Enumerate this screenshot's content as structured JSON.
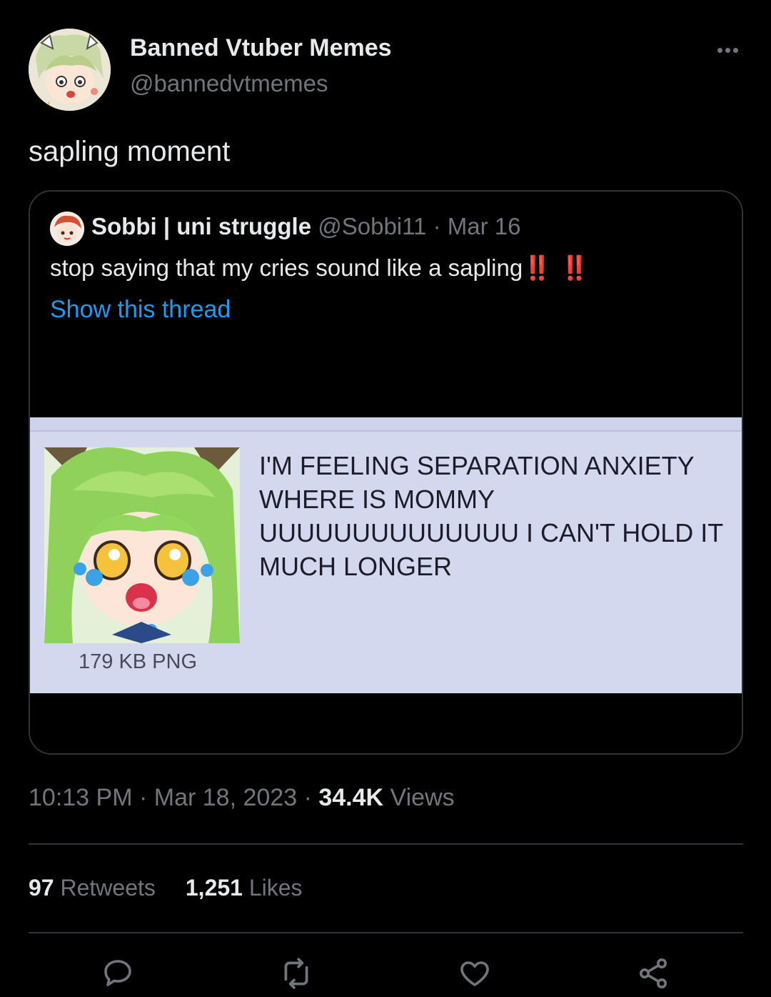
{
  "author": {
    "name": "Banned Vtuber Memes",
    "handle": "@bannedvtmemes"
  },
  "tweet": {
    "text": "sapling moment"
  },
  "quote": {
    "name": "Sobbi | uni struggle",
    "handle": "@Sobbi11",
    "separator": "·",
    "date": "Mar 16",
    "text": "stop saying that my cries sound like a sapling",
    "emphasis": "‼️ ‼️",
    "show_thread": "Show this thread",
    "media": {
      "caption": "179 KB PNG",
      "text": "I'M FEELING SEPARATION ANXIETY WHERE IS MOMMY UUUUUUUUUUUUUU I CAN'T HOLD IT MUCH LONGER"
    }
  },
  "meta": {
    "time": "10:13 PM",
    "sep1": "·",
    "date": "Mar 18, 2023",
    "sep2": "·",
    "views_count": "34.4K",
    "views_label": "Views"
  },
  "stats": {
    "retweets_count": "97",
    "retweets_label": "Retweets",
    "likes_count": "1,251",
    "likes_label": "Likes"
  },
  "actions": {
    "reply_icon": "reply-icon",
    "retweet_icon": "retweet-icon",
    "like_icon": "heart-icon",
    "share_icon": "share-icon"
  },
  "colors": {
    "background": "#000000",
    "link": "#1d9bf0",
    "muted": "#71767b",
    "text": "#e7e9ea",
    "emphasis": "#d0142b"
  }
}
